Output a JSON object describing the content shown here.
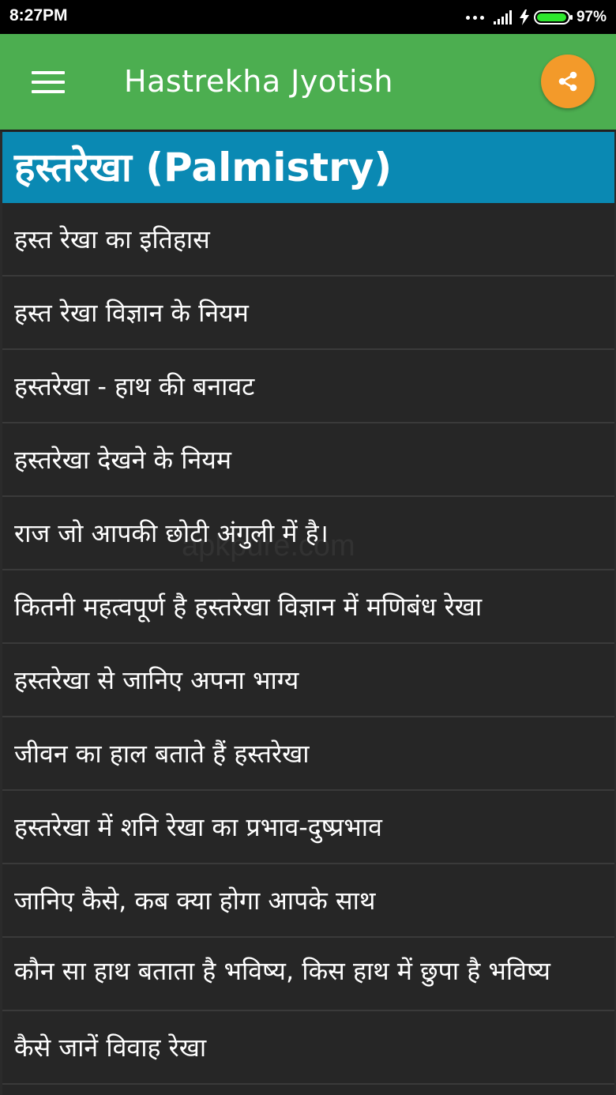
{
  "status_bar": {
    "time": "8:27PM",
    "battery_percent": "97%",
    "battery_level": 0.97,
    "icons": [
      "more-dots-icon",
      "signal-icon",
      "charging-bolt-icon",
      "battery-icon"
    ]
  },
  "app_bar": {
    "title": "Hastrekha Jyotish",
    "menu_icon": "hamburger-menu-icon",
    "share_icon": "share-icon",
    "colors": {
      "app_bar": "#4cae50",
      "share_button": "#f39a2a",
      "section_header": "#0a89b3",
      "list_background": "#262626"
    }
  },
  "section": {
    "title": "हस्तरेखा (Palmistry)"
  },
  "watermark": "apkpure.com",
  "list": {
    "items": [
      "हस्त रेखा का इतिहास",
      "हस्त रेखा विज्ञान के नियम",
      "हस्तरेखा - हाथ की बनावट",
      "हस्तरेखा देखने के नियम",
      "राज जो आपकी छोटी अंगुली में है।",
      "कितनी महत्वपूर्ण है हस्तरेखा विज्ञान में मणिबंध रेखा",
      "हस्तरेखा से जानिए अपना भाग्य",
      "जीवन का हाल बताते हैं हस्तरेखा",
      "हस्तरेखा में शनि रेखा का प्रभाव-दुष्प्रभाव",
      "जानिए कैसे, कब क्या होगा आपके साथ",
      "कौन सा हाथ बताता है भविष्य, किस हाथ में छुपा है भविष्य",
      "कैसे जानें विवाह रेखा"
    ]
  }
}
